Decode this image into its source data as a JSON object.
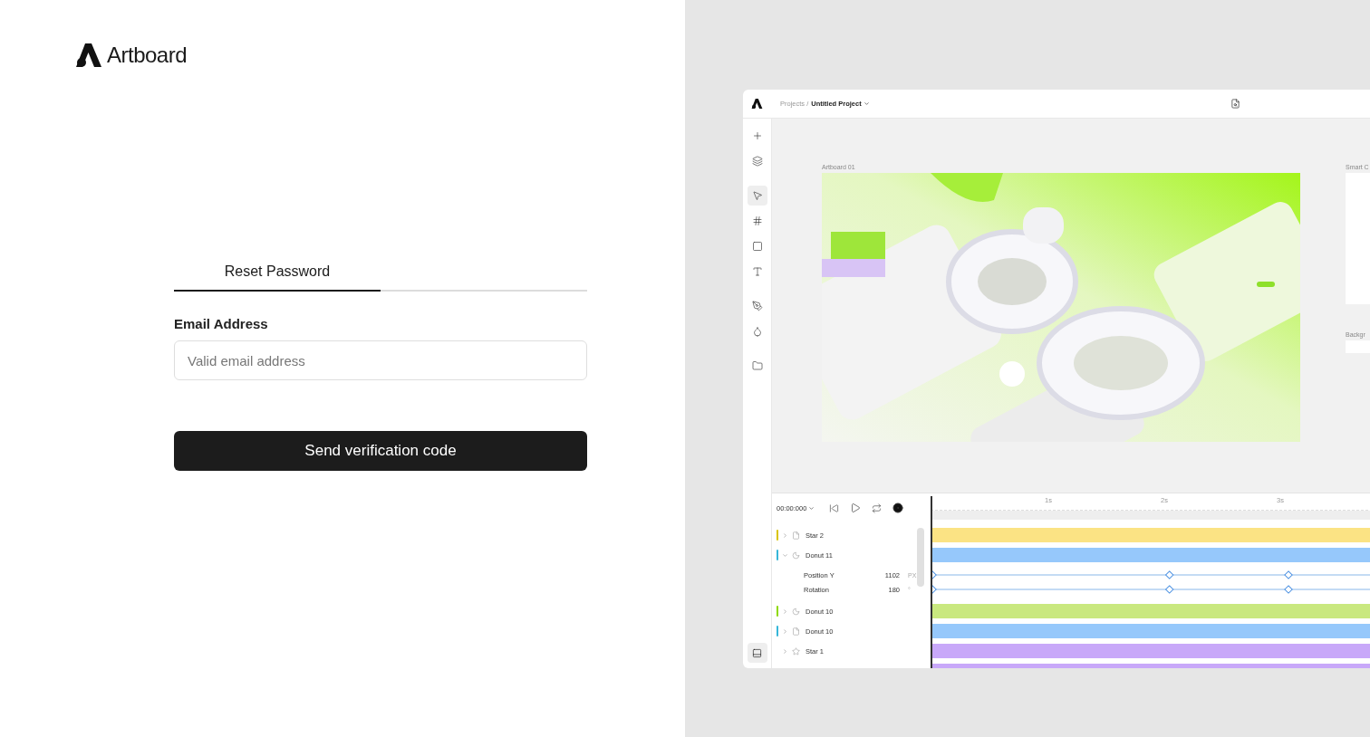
{
  "brand": {
    "name": "Artboard"
  },
  "tabs": [
    {
      "label": "Reset Password",
      "selected": true
    }
  ],
  "form": {
    "email_label": "Email Address",
    "email_placeholder": "Valid email address",
    "submit": "Send verification code"
  },
  "preview": {
    "breadcrumb": {
      "parent": "Projects /",
      "current": "Untitled Project"
    },
    "tools": [
      {
        "kind": "plus",
        "selected": false
      },
      {
        "kind": "layers",
        "selected": false
      },
      {
        "kind": "pointer",
        "selected": true
      },
      {
        "kind": "frame",
        "selected": false
      },
      {
        "kind": "shape",
        "selected": false
      },
      {
        "kind": "text",
        "selected": false
      },
      {
        "kind": "pen",
        "selected": false
      },
      {
        "kind": "drop",
        "selected": false
      },
      {
        "kind": "folder",
        "selected": false
      }
    ],
    "artboard_label": "Artboard 01",
    "side_labels": [
      "Smart C",
      "Backgr"
    ],
    "timeline": {
      "time": "00:00:000",
      "ticks": [
        "1s",
        "2s",
        "3s"
      ],
      "rows": [
        {
          "kind": "page",
          "name": "Star 2",
          "color": "#fbe384",
          "marker": true,
          "expanded": false
        },
        {
          "kind": "donut",
          "name": "Donut 11",
          "color": "#96c8fb",
          "marker": true,
          "expanded": true
        },
        {
          "kind": "property",
          "name": "Position Y",
          "value": "1102",
          "unit": "PX"
        },
        {
          "kind": "property",
          "name": "Rotation",
          "value": "180",
          "unit": "°"
        },
        {
          "kind": "donut",
          "name": "Donut 10",
          "color": "#c9e87f",
          "marker": true,
          "expanded": false
        },
        {
          "kind": "page",
          "name": "Donut 10",
          "color": "#96c8fb",
          "marker": true,
          "expanded": false
        },
        {
          "kind": "star",
          "name": "Star 1",
          "color": "#c8a8f9",
          "marker": false,
          "expanded": false
        }
      ]
    }
  }
}
